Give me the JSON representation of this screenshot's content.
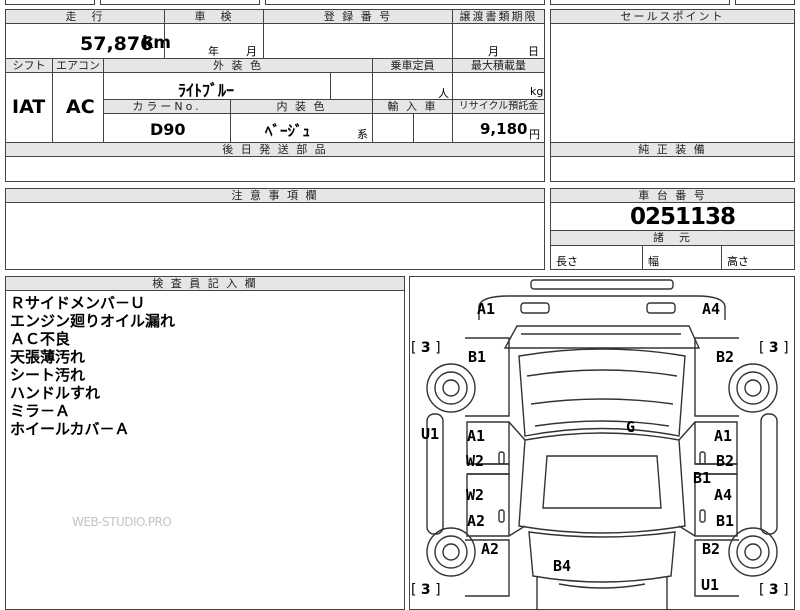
{
  "headers": {
    "mileage": "走　行",
    "inspection": "車　検",
    "registration": "登 録 番 号",
    "transfer_deadline": "譲渡書類期限",
    "sales_point": "セールスポイント",
    "shift": "シフト",
    "aircon": "エアコン",
    "exterior_color": "外 装 色",
    "capacity": "乗車定員",
    "max_load": "最大積載量",
    "color_no": "カラーNo.",
    "interior_color": "内 装 色",
    "import": "輸 入 車",
    "recycle": "リサイクル預託金",
    "later_parts": "後 日 発 送 部 品",
    "genuine_equipment": "純 正 装 備",
    "caution": "注 意 事 項 欄",
    "chassis_no": "車 台 番 号",
    "specs": "諸　元",
    "length": "長さ",
    "width": "幅",
    "height": "高さ",
    "inspector_notes": "検 査 員 記 入 欄"
  },
  "values": {
    "mileage": "57,876",
    "mileage_unit": "km",
    "year_label": "年",
    "month_label": "月",
    "month_label2": "月",
    "day_label": "日",
    "shift": "IAT",
    "aircon": "AC",
    "exterior_color": "ﾗｲﾄﾌﾞﾙｰ",
    "capacity_unit": "人",
    "load_unit": "kg",
    "color_no": "D90",
    "interior_color": "ﾍﾞｰｼﾞｭ",
    "interior_suffix": "系",
    "recycle": "9,180",
    "recycle_unit": "円",
    "chassis_no": "0251138"
  },
  "inspector_notes": [
    "Ｒサイドメンバ－Ｕ",
    "エンジン廻りオイル漏れ",
    "ＡＣ不良",
    "天張薄汚れ",
    "シート汚れ",
    "ハンドルすれ",
    "ミラ－Ａ",
    "ホイールカバ－Ａ"
  ],
  "watermark": "WEB-STUDIO.PRO",
  "diagram": {
    "front_left": "A1",
    "front_right": "A4",
    "wheel_count_tl": "3",
    "wheel_count_tr": "3",
    "wheel_count_bl": "3",
    "wheel_count_br": "3",
    "fender_left": "B1",
    "fender_right": "B2",
    "left_side": "U1",
    "roof": "G",
    "left_door_f_a": "A1",
    "left_door_f_w": "W2",
    "left_door_r_w": "W2",
    "left_door_r_a": "A2",
    "right_door_f_a": "A1",
    "right_door_f_b": "B2",
    "right_door_mid": "B1",
    "right_door_r_a": "A4",
    "right_door_r_b": "B1",
    "rear_left": "A2",
    "rear_right": "B2",
    "rear_center": "B4",
    "rear_u": "U1"
  }
}
